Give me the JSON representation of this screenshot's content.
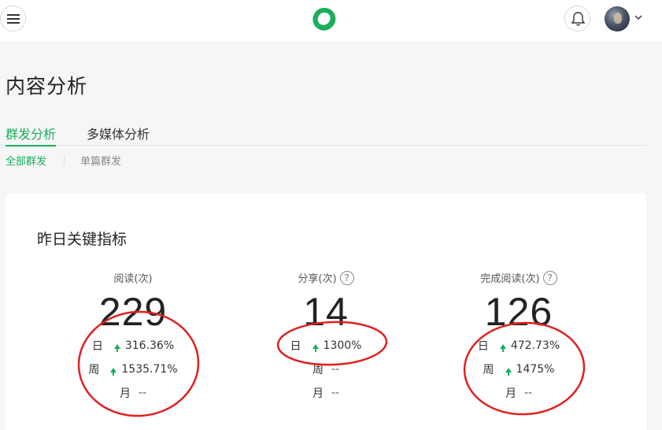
{
  "header": {
    "menu_icon": "hamburger-menu-icon",
    "logo_icon": "wechat-mp-logo-icon",
    "bell_icon": "bell-icon",
    "chevron_icon": "chevron-down-icon"
  },
  "page": {
    "title": "内容分析"
  },
  "tabs": [
    {
      "label": "群发分析",
      "active": true
    },
    {
      "label": "多媒体分析",
      "active": false
    }
  ],
  "subtabs": [
    {
      "label": "全部群发",
      "active": true
    },
    {
      "label": "单篇群发",
      "active": false
    }
  ],
  "card": {
    "title": "昨日关键指标",
    "metrics": [
      {
        "label": "阅读(次)",
        "has_help": false,
        "value": "229",
        "rows": [
          {
            "period": "日",
            "trend": "up",
            "value": "316.36%"
          },
          {
            "period": "周",
            "trend": "up",
            "value": "1535.71%"
          },
          {
            "period": "月",
            "trend": "none",
            "value": "--"
          }
        ]
      },
      {
        "label": "分享(次)",
        "has_help": true,
        "help_glyph": "?",
        "value": "14",
        "rows": [
          {
            "period": "日",
            "trend": "up",
            "value": "1300%"
          },
          {
            "period": "周",
            "trend": "none",
            "value": "--"
          },
          {
            "period": "月",
            "trend": "none",
            "value": "--"
          }
        ]
      },
      {
        "label": "完成阅读(次)",
        "has_help": true,
        "help_glyph": "?",
        "value": "126",
        "rows": [
          {
            "period": "日",
            "trend": "up",
            "value": "472.73%"
          },
          {
            "period": "周",
            "trend": "up",
            "value": "1475%"
          },
          {
            "period": "月",
            "trend": "none",
            "value": "--"
          }
        ]
      }
    ]
  },
  "colors": {
    "accent": "#1aad5a",
    "annotation": "#e02020",
    "background": "#f6f6f6"
  }
}
